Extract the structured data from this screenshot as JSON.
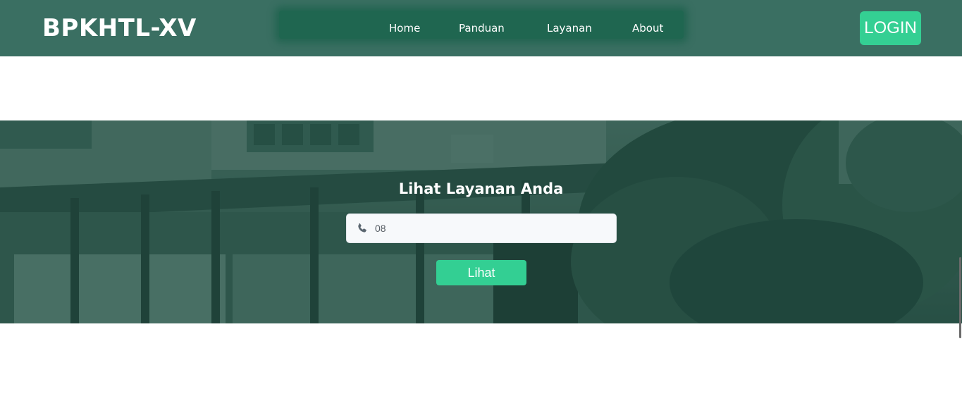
{
  "header": {
    "brand": "BPKHTL-XV",
    "nav": [
      {
        "label": "Home"
      },
      {
        "label": "Panduan"
      },
      {
        "label": "Layanan"
      },
      {
        "label": "About"
      }
    ],
    "login_label": "LOGIN"
  },
  "hero": {
    "title": "Lihat Layanan Anda",
    "phone_input": {
      "value": "08",
      "icon": "phone-icon"
    },
    "submit_label": "Lihat"
  },
  "colors": {
    "header_bg": "#3a6f62",
    "nav_bg": "#1f6650",
    "accent": "#34cf93",
    "hero_overlay": "#1e4d41",
    "input_bg": "#f7f9fb"
  }
}
